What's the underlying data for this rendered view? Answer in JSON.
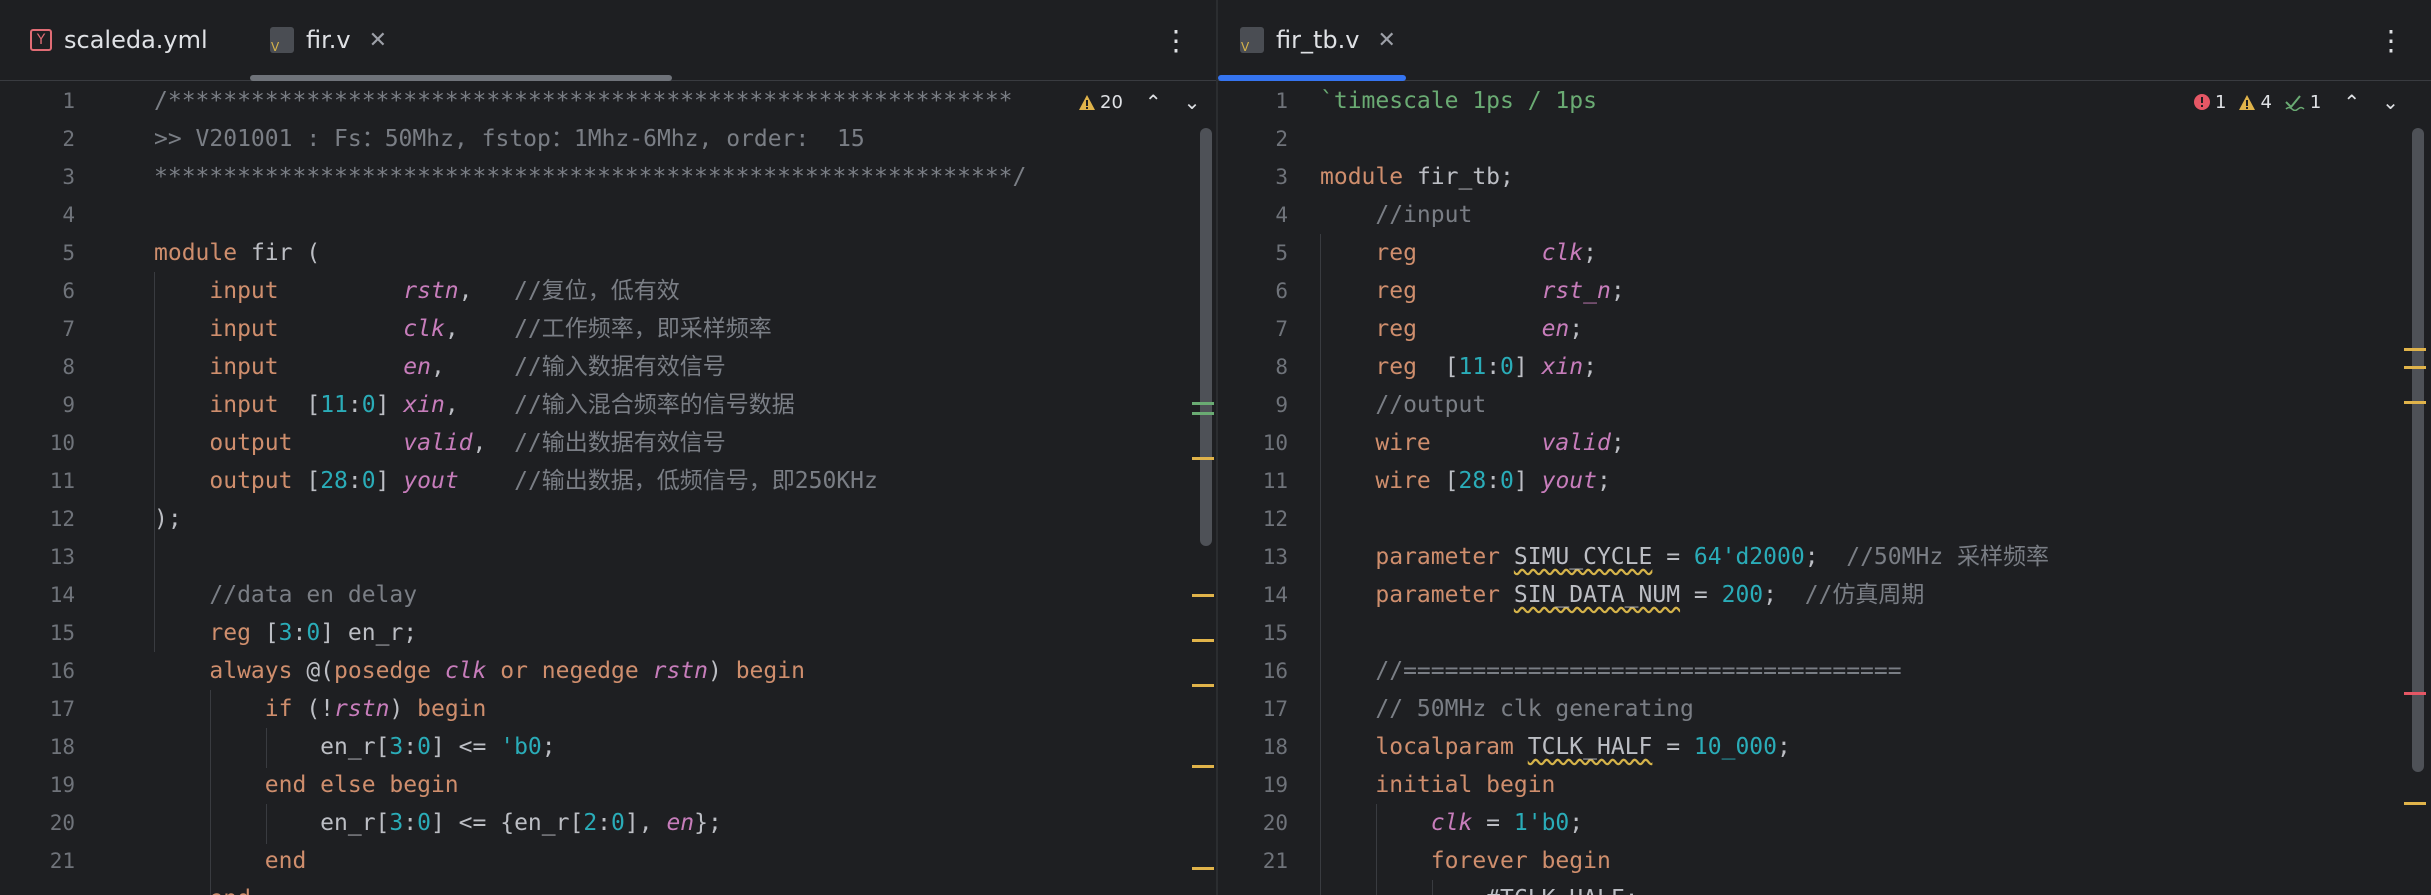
{
  "left": {
    "tabs": [
      {
        "icon": "yaml-file-icon",
        "label": "scaleda.yml",
        "active": false
      },
      {
        "icon": "verilog-file-icon",
        "label": "fir.v",
        "active": true,
        "close": "✕"
      }
    ],
    "menu_glyph": "⋮",
    "inspection": {
      "warning_count": "20"
    },
    "line_numbers": [
      "1",
      "2",
      "3",
      "4",
      "5",
      "6",
      "7",
      "8",
      "9",
      "10",
      "11",
      "12",
      "13",
      "14",
      "15",
      "16",
      "17",
      "18",
      "19",
      "20",
      "21"
    ]
  },
  "right": {
    "tabs": [
      {
        "icon": "verilog-file-icon",
        "label": "fir_tb.v",
        "active": true,
        "close": "✕"
      }
    ],
    "menu_glyph": "⋮",
    "inspection": {
      "error_count": "1",
      "warning_count": "4",
      "weak_warning_count": "1"
    },
    "line_numbers": [
      "1",
      "2",
      "3",
      "4",
      "5",
      "6",
      "7",
      "8",
      "9",
      "10",
      "11",
      "12",
      "13",
      "14",
      "15",
      "16",
      "17",
      "18",
      "19",
      "20",
      "21"
    ]
  },
  "colors": {
    "background": "#1e1f22",
    "keyword": "#cf8e6d",
    "number": "#2aacb8",
    "italic_identifier": "#c77dbb",
    "comment": "#7a7e85",
    "text": "#bcbec4",
    "tab_underline_left": "#6f737a",
    "tab_underline_right": "#3574f0",
    "warning": "#e0b34a",
    "error": "#e55765"
  }
}
